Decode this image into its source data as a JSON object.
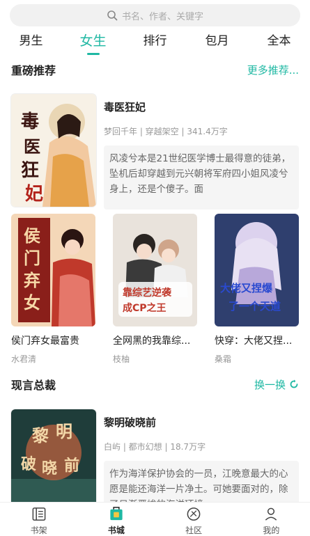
{
  "search": {
    "placeholder": "书名、作者、关键字"
  },
  "tabs": [
    {
      "label": "男生"
    },
    {
      "label": "女生"
    },
    {
      "label": "排行"
    },
    {
      "label": "包月"
    },
    {
      "label": "全本"
    }
  ],
  "active_tab": "女生",
  "accent_color": "#1fb8a3",
  "section1": {
    "title": "重磅推荐",
    "link": "更多推荐...",
    "featured": {
      "title": "毒医狂妃",
      "meta": "梦回千年 | 穿越架空 | 341.4万字",
      "desc": "风凌兮本是21世纪医学博士最得意的徒弟，坠机后却穿越到元兴朝将军府四小姐风凌兮身上，还是个傻子。面",
      "cover_text": "毒医狂妃"
    },
    "grid": [
      {
        "title": "侯门弃女最富贵",
        "author": "水君清",
        "cover_text": "侯门弃女"
      },
      {
        "title": "全网黑的我靠综...",
        "author": "枝柚",
        "cover_text": "靠综艺逆袭成CP之王"
      },
      {
        "title": "快穿：大佬又捏...",
        "author": "桑霜",
        "cover_text": "大佬又捏爆了一个天道"
      }
    ]
  },
  "section2": {
    "title": "现言总裁",
    "link": "换一换",
    "featured": {
      "title": "黎明破晓前",
      "meta": "白屿 | 都市幻想 | 18.7万字",
      "desc": "作为海洋保护协会的一员，江晚意最大的心愿是能还海洋一片净土。可她要面对的，除了日渐严峻的海洋环境",
      "cover_text": "黎明破晓前"
    }
  },
  "bottom_nav": [
    {
      "label": "书架",
      "icon": "bookshelf-icon"
    },
    {
      "label": "书城",
      "icon": "bookstore-icon"
    },
    {
      "label": "社区",
      "icon": "community-icon"
    },
    {
      "label": "我的",
      "icon": "profile-icon"
    }
  ]
}
